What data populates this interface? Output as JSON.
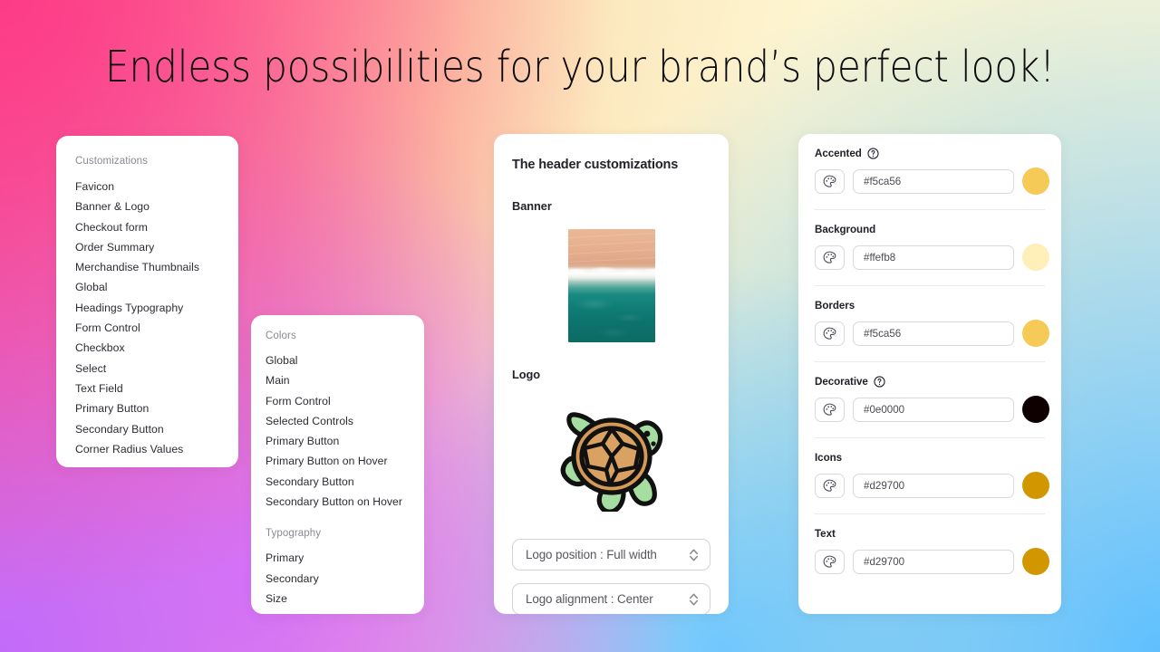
{
  "headline": "Endless possibilities for your brand’s perfect look!",
  "background": {
    "pink": "#fd3c86",
    "cream": "#fdf4cd",
    "purple": "#c26bfb",
    "blue": "#5fc0fd"
  },
  "nav_customizations": {
    "header": "Customizations",
    "items": [
      "Favicon",
      "Banner & Logo",
      "Checkout form",
      "Order Summary",
      "Merchandise Thumbnails",
      "Global",
      "Headings Typography",
      "Form Control",
      "Checkbox",
      "Select",
      "Text Field",
      "Primary Button",
      "Secondary Button",
      "Corner Radius Values"
    ]
  },
  "nav_colors": {
    "header": "Colors",
    "items": [
      "Global",
      "Main",
      "Form Control",
      "Selected Controls",
      "Primary Button",
      "Primary Button on Hover",
      "Secondary Button",
      "Secondary Button on Hover"
    ],
    "typography_header": "Typography",
    "typography_items": [
      "Primary",
      "Secondary",
      "Size"
    ]
  },
  "header_preview": {
    "title": "The header customizations",
    "banner_label": "Banner",
    "logo_label": "Logo",
    "banner_alt": "beach-aerial-photo",
    "logo_alt": "turtle-logo",
    "dropdowns": [
      {
        "label": "Logo position : Full width",
        "name": "logo-position-select"
      },
      {
        "label": "Logo alignment : Center",
        "name": "logo-alignment-select"
      }
    ]
  },
  "palette": {
    "rows": [
      {
        "title": "Accented",
        "help": true,
        "hex": "#f5ca56",
        "swatch": "#f5ca56"
      },
      {
        "title": "Background",
        "help": false,
        "hex": "#ffefb8",
        "swatch": "#ffefb8"
      },
      {
        "title": "Borders",
        "help": false,
        "hex": "#f5ca56",
        "swatch": "#f5ca56"
      },
      {
        "title": "Decorative",
        "help": true,
        "hex": "#0e0000",
        "swatch": "#0e0000"
      },
      {
        "title": "Icons",
        "help": false,
        "hex": "#d29700",
        "swatch": "#d29700"
      },
      {
        "title": "Text",
        "help": false,
        "hex": "#d29700",
        "swatch": "#d29700"
      }
    ],
    "palette_icon": "palette-icon",
    "help_icon": "help-circle-icon"
  }
}
